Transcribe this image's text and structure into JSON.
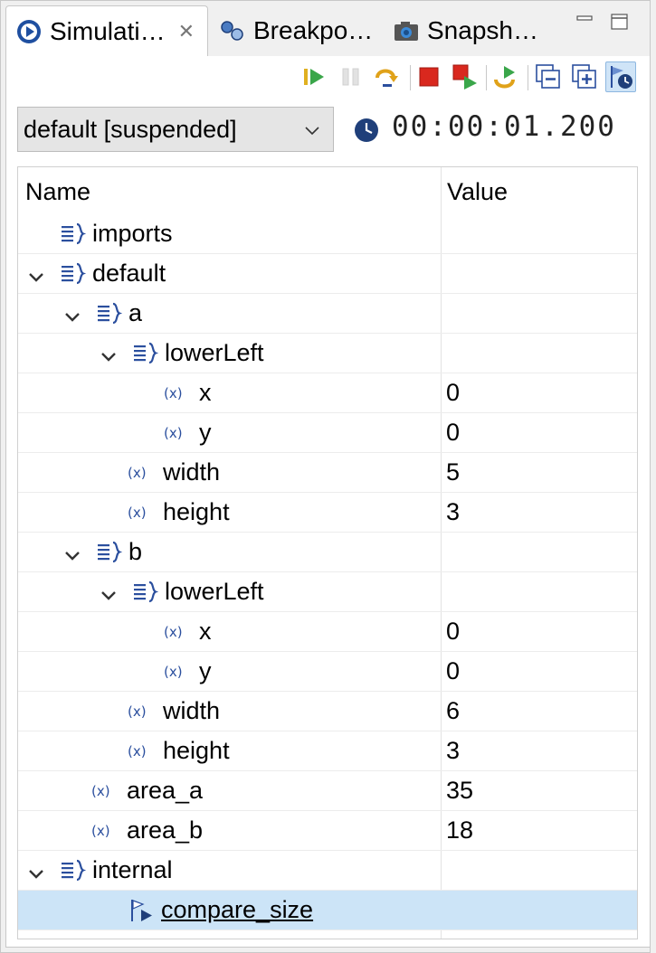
{
  "tabs": [
    {
      "label": "Simulati…",
      "icon": "simulation-icon",
      "active": true,
      "closable": true
    },
    {
      "label": "Breakpo…",
      "icon": "breakpoints-icon",
      "active": false
    },
    {
      "label": "Snapsh…",
      "icon": "camera-icon",
      "active": false
    }
  ],
  "toolbar": {
    "buttons": [
      {
        "name": "resume-button",
        "icon": "resume-icon",
        "enabled": true
      },
      {
        "name": "suspend-button",
        "icon": "suspend-icon",
        "enabled": false
      },
      {
        "name": "step-over-button",
        "icon": "step-over-icon",
        "enabled": true
      },
      {
        "name": "terminate-button",
        "icon": "terminate-icon",
        "enabled": true
      },
      {
        "name": "terminate-relaunch-button",
        "icon": "terminate-relaunch-icon",
        "enabled": true
      },
      {
        "name": "restart-button",
        "icon": "restart-icon",
        "enabled": true
      },
      {
        "name": "collapse-all-button",
        "icon": "collapse-all-icon",
        "enabled": true
      },
      {
        "name": "expand-all-button",
        "icon": "expand-all-icon",
        "enabled": true
      },
      {
        "name": "show-tasks-button",
        "icon": "task-clock-icon",
        "enabled": true,
        "checked": true
      }
    ]
  },
  "session": {
    "selected": "default [suspended]",
    "time": "00:00:01.200"
  },
  "table": {
    "columns": [
      "Name",
      "Value"
    ],
    "rows": [
      {
        "name": "imports",
        "value": "",
        "kind": "scope",
        "depth": 0,
        "expandable": false
      },
      {
        "name": "default",
        "value": "",
        "kind": "scope",
        "depth": 0,
        "expandable": true
      },
      {
        "name": "a",
        "value": "",
        "kind": "scope",
        "depth": 1,
        "expandable": true
      },
      {
        "name": "lowerLeft",
        "value": "",
        "kind": "scope",
        "depth": 2,
        "expandable": true
      },
      {
        "name": "x",
        "value": "0",
        "kind": "variable",
        "depth": 3
      },
      {
        "name": "y",
        "value": "0",
        "kind": "variable",
        "depth": 3
      },
      {
        "name": "width",
        "value": "5",
        "kind": "variable",
        "depth": 2
      },
      {
        "name": "height",
        "value": "3",
        "kind": "variable",
        "depth": 2
      },
      {
        "name": "b",
        "value": "",
        "kind": "scope",
        "depth": 1,
        "expandable": true
      },
      {
        "name": "lowerLeft",
        "value": "",
        "kind": "scope",
        "depth": 2,
        "expandable": true
      },
      {
        "name": "x",
        "value": "0",
        "kind": "variable",
        "depth": 3
      },
      {
        "name": "y",
        "value": "0",
        "kind": "variable",
        "depth": 3
      },
      {
        "name": "width",
        "value": "6",
        "kind": "variable",
        "depth": 2
      },
      {
        "name": "height",
        "value": "3",
        "kind": "variable",
        "depth": 2
      },
      {
        "name": "area_a",
        "value": "35",
        "kind": "variable",
        "depth": 1
      },
      {
        "name": "area_b",
        "value": "18",
        "kind": "variable",
        "depth": 1
      },
      {
        "name": "internal",
        "value": "",
        "kind": "scope",
        "depth": 0,
        "expandable": true
      },
      {
        "name": "compare_size",
        "value": "",
        "kind": "task",
        "depth": 1,
        "selected": true,
        "link": true
      }
    ]
  },
  "colors": {
    "selection": "#cce4f7",
    "icon_blue": "#2b4f9e",
    "stop_red": "#d9281e",
    "run_green": "#3aa64a",
    "step_orange": "#e0a21a"
  }
}
